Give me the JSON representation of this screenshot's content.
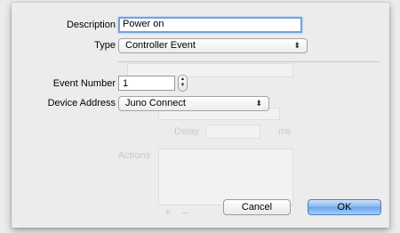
{
  "form": {
    "description_label": "Description",
    "description_value": "Power on",
    "type_label": "Type",
    "type_value": "Controller Event",
    "event_number_label": "Event Number",
    "event_number_value": "1",
    "device_address_label": "Device Address",
    "device_address_value": "Juno Connect"
  },
  "background_text": {
    "delay_label": "Delay",
    "ms_label": "ms",
    "actions_label": "Actions",
    "add_symbol": "+",
    "remove_symbol": "–"
  },
  "buttons": {
    "cancel": "Cancel",
    "ok": "OK"
  },
  "icons": {
    "popup_arrows": "⬍",
    "stepper_up": "▲",
    "stepper_down": "▼"
  },
  "colors": {
    "focus_ring": "#6fa3e6",
    "default_button": "#6aa6ec"
  }
}
